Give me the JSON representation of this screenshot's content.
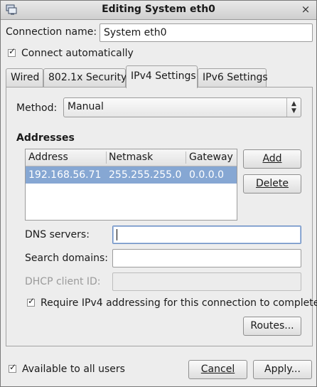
{
  "window": {
    "title": "Editing System eth0",
    "icon": "network-icon",
    "close": "×"
  },
  "connection_name": {
    "label": "Connection name:",
    "value": "System eth0"
  },
  "connect_auto": {
    "label": "Connect automatically",
    "checked": true
  },
  "tabs": [
    {
      "label": "Wired"
    },
    {
      "label": "802.1x Security"
    },
    {
      "label": "IPv4 Settings",
      "active": true
    },
    {
      "label": "IPv6 Settings"
    }
  ],
  "method": {
    "label": "Method:",
    "value": "Manual"
  },
  "addresses": {
    "heading": "Addresses",
    "columns": [
      "Address",
      "Netmask",
      "Gateway"
    ],
    "rows": [
      [
        "192.168.56.71",
        "255.255.255.0",
        "0.0.0.0"
      ]
    ],
    "add_label": "Add",
    "delete_label": "Delete"
  },
  "dns": {
    "label": "DNS servers:",
    "value": ""
  },
  "search_domains": {
    "label": "Search domains:",
    "value": ""
  },
  "dhcp_client_id": {
    "label": "DHCP client ID:",
    "value": ""
  },
  "require_ipv4": {
    "label": "Require IPv4 addressing for this connection to complete",
    "checked": true
  },
  "routes_label": "Routes...",
  "available_all": {
    "label": "Available to all users",
    "checked": true
  },
  "cancel_label": "Cancel",
  "apply_label": "Apply...",
  "colors": {
    "selection": "#86a7d3",
    "focus_border": "#6b8ec3"
  }
}
